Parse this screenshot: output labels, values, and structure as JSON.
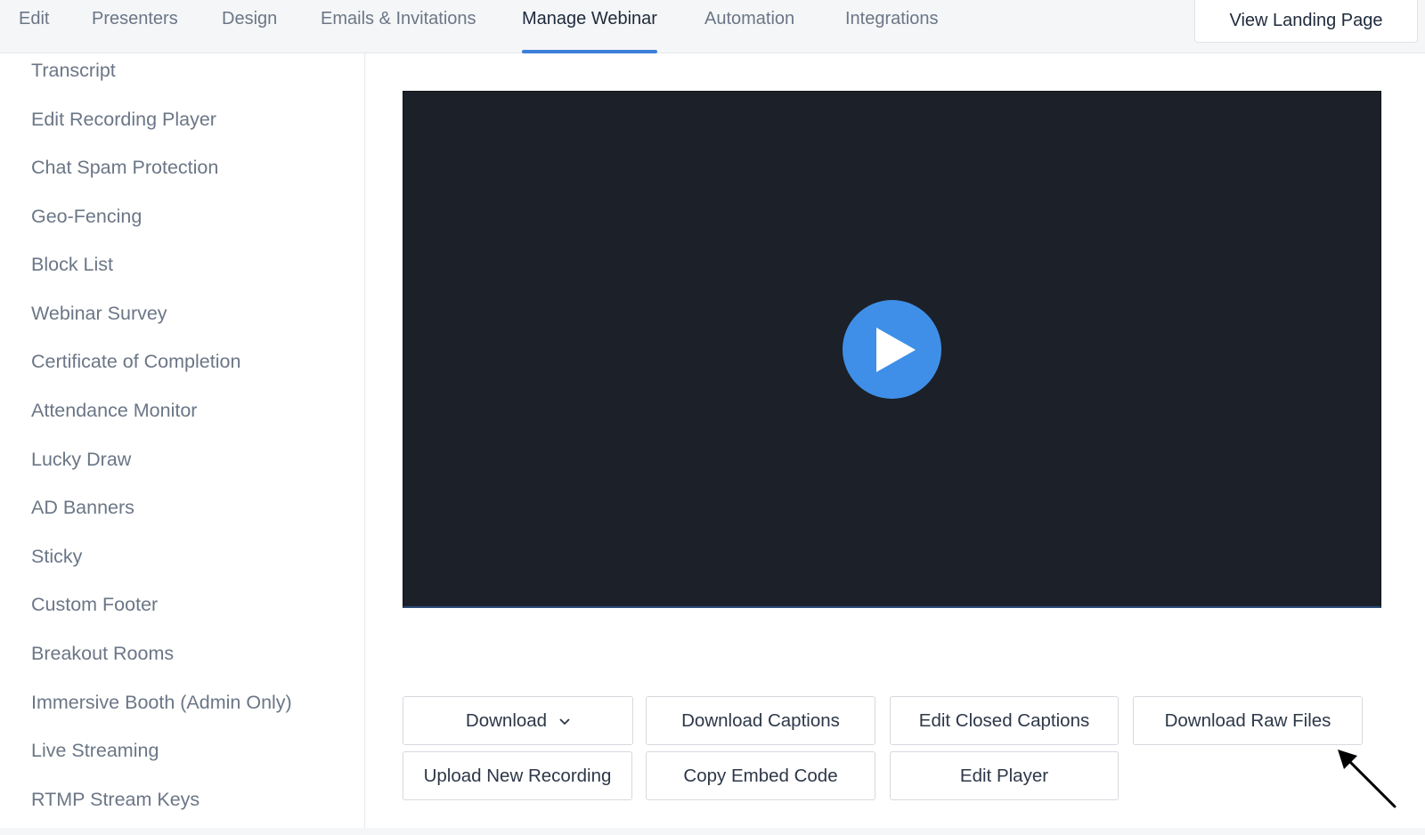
{
  "tabs": [
    {
      "label": "Edit"
    },
    {
      "label": "Presenters"
    },
    {
      "label": "Design"
    },
    {
      "label": "Emails & Invitations"
    },
    {
      "label": "Manage Webinar",
      "active": true
    },
    {
      "label": "Automation"
    },
    {
      "label": "Integrations"
    }
  ],
  "header": {
    "view_landing_label": "View Landing Page"
  },
  "sidebar": {
    "items": [
      {
        "label": "Transcript"
      },
      {
        "label": "Edit Recording Player"
      },
      {
        "label": "Chat Spam Protection"
      },
      {
        "label": "Geo-Fencing"
      },
      {
        "label": "Block List"
      },
      {
        "label": "Webinar Survey"
      },
      {
        "label": "Certificate of Completion"
      },
      {
        "label": "Attendance Monitor"
      },
      {
        "label": "Lucky Draw"
      },
      {
        "label": "AD Banners"
      },
      {
        "label": "Sticky"
      },
      {
        "label": "Custom Footer"
      },
      {
        "label": "Breakout Rooms"
      },
      {
        "label": "Immersive Booth (Admin Only)"
      },
      {
        "label": "Live Streaming"
      },
      {
        "label": "RTMP Stream Keys"
      }
    ]
  },
  "player": {
    "play_icon": "play-icon"
  },
  "actions": {
    "download": "Download",
    "download_captions": "Download Captions",
    "edit_closed_captions": "Edit Closed Captions",
    "download_raw_files": "Download Raw Files",
    "upload_new_recording": "Upload New Recording",
    "copy_embed_code": "Copy Embed Code",
    "edit_player": "Edit Player"
  },
  "colors": {
    "accent": "#3d7fd9",
    "play_button": "#3f8fe8",
    "player_bg": "#1c2028"
  }
}
